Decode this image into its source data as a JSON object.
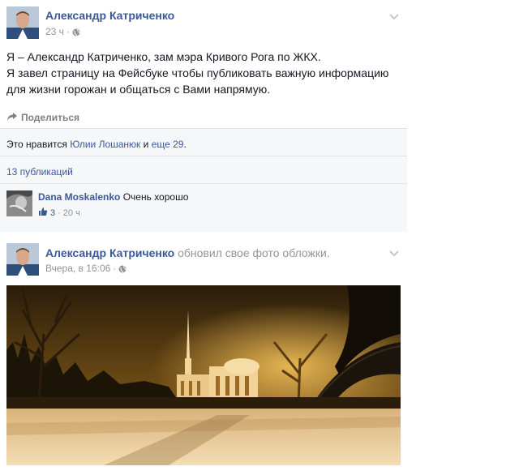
{
  "post1": {
    "author": "Александр Катриченко",
    "time": "23 ч",
    "text_lines": [
      "Я – Александр Катриченко, зам мэра Кривого Рога по ЖКХ.",
      "Я завел страницу на Фейсбуке чтобы публиковать важную информацию",
      "для жизни горожан и общаться с Вами напрямую."
    ],
    "share_label": "Поделиться",
    "likes": {
      "prefix": "Это нравится",
      "name": "Юлии Лошанюк",
      "connector": "и",
      "others": "еще 29",
      "suffix": "."
    },
    "publications": "13 публикаций",
    "comment": {
      "author": "Dana Moskalenko",
      "text": "Очень хорошо",
      "likes": "3",
      "separator": "·",
      "time": "20 ч"
    }
  },
  "post2": {
    "author": "Александр Катриченко",
    "action": "обновил свое фото обложки.",
    "time": "Вчера, в 16:06",
    "separator": "·"
  },
  "post1_separator": "·",
  "icons": {
    "globe": "globe-icon",
    "chevron": "chevron-down-icon",
    "share": "share-icon",
    "thumb": "thumbs-up-icon"
  },
  "colors": {
    "link": "#3b5998",
    "meta": "#90949c",
    "ufi_bg": "#f6f7f9"
  }
}
